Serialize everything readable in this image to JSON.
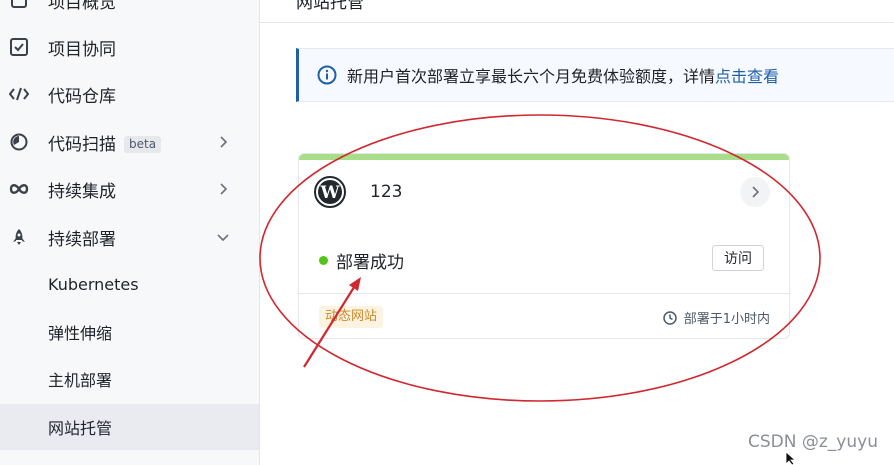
{
  "sidebar": {
    "items": [
      {
        "label": "项目概览",
        "icon": "overview-icon"
      },
      {
        "label": "项目协同",
        "icon": "checkbox-icon"
      },
      {
        "label": "代码仓库",
        "icon": "code-icon"
      },
      {
        "label": "代码扫描",
        "badge": "beta",
        "icon": "scan-icon"
      },
      {
        "label": "持续集成",
        "icon": "infinity-icon"
      },
      {
        "label": "持续部署",
        "icon": "rocket-icon"
      }
    ],
    "sub_items": [
      {
        "label": "Kubernetes"
      },
      {
        "label": "弹性伸缩"
      },
      {
        "label": "主机部署"
      },
      {
        "label": "网站托管"
      }
    ]
  },
  "header": {
    "title_partial": "网站托管"
  },
  "notice": {
    "text": "新用户首次部署立享最长六个月免费体验额度，详情",
    "link": "点击查看"
  },
  "site_card": {
    "name": "123",
    "status": "部署成功",
    "status_color": "#52c41a",
    "visit_label": "访问",
    "tag": "动态网站",
    "deploy_time": "部署于1小时内",
    "accent_color": "#a8dd8a"
  },
  "watermark": "CSDN @z_yuyu",
  "annotation_color": "#d0282e"
}
